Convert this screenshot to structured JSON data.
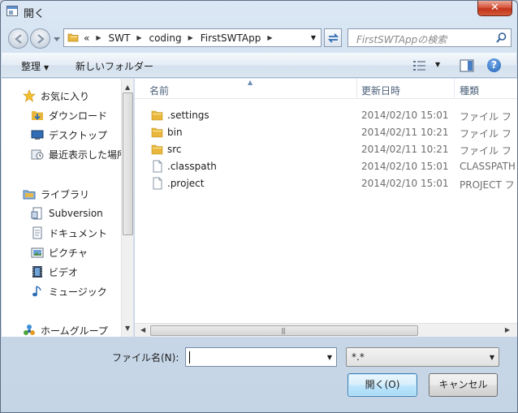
{
  "window": {
    "title": "開く",
    "close_symbol": "✕"
  },
  "address_bar": {
    "root_marker": "«",
    "crumbs": [
      "SWT",
      "coding",
      "FirstSWTApp"
    ]
  },
  "search": {
    "placeholder": "FirstSWTAppの検索"
  },
  "toolbar": {
    "organize_label": "整理",
    "new_folder_label": "新しいフォルダー",
    "help_label": "?"
  },
  "sidebar": {
    "items": [
      {
        "label": "お気に入り",
        "icon": "star-icon"
      },
      {
        "label": "ダウンロード",
        "icon": "downloads-folder-icon"
      },
      {
        "label": "デスクトップ",
        "icon": "desktop-icon"
      },
      {
        "label": "最近表示した場所",
        "icon": "recent-places-icon"
      },
      {
        "label": "ライブラリ",
        "icon": "library-icon"
      },
      {
        "label": "Subversion",
        "icon": "library-doc-icon"
      },
      {
        "label": "ドキュメント",
        "icon": "documents-icon"
      },
      {
        "label": "ピクチャ",
        "icon": "pictures-icon"
      },
      {
        "label": "ビデオ",
        "icon": "videos-icon"
      },
      {
        "label": "ミュージック",
        "icon": "music-icon"
      },
      {
        "label": "ホームグループ",
        "icon": "homegroup-icon"
      }
    ]
  },
  "file_list": {
    "columns": [
      "名前",
      "更新日時",
      "種類"
    ],
    "rows": [
      {
        "name": ".settings",
        "date": "2014/02/10 15:01",
        "type": "ファイル フ",
        "icon": "folder-icon"
      },
      {
        "name": "bin",
        "date": "2014/02/11 10:21",
        "type": "ファイル フ",
        "icon": "folder-icon"
      },
      {
        "name": "src",
        "date": "2014/02/11 10:21",
        "type": "ファイル フ",
        "icon": "folder-icon"
      },
      {
        "name": ".classpath",
        "date": "2014/02/10 15:01",
        "type": "CLASSPATH",
        "icon": "file-icon"
      },
      {
        "name": ".project",
        "date": "2014/02/10 15:01",
        "type": "PROJECT フ",
        "icon": "file-icon"
      }
    ]
  },
  "footer": {
    "filename_label": "ファイル名(N):",
    "filename_value": "",
    "filter_value": "*.*",
    "open_label": "開く(O)",
    "cancel_label": "キャンセル"
  },
  "colors": {
    "accent": "#3c7fb1",
    "close": "#c2351a",
    "folder": "#e8b73c"
  }
}
